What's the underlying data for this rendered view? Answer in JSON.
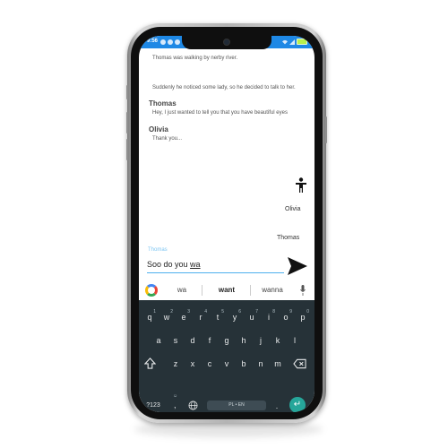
{
  "status": {
    "time": "9:56"
  },
  "story": {
    "narration_1": "Thomas was walking by nerby river.",
    "narration_2": "Suddenly he noticed some lady, so he decided to talk to her.",
    "dialogue": [
      {
        "speaker": "Thomas",
        "text": "Hey, I just wanted to tell you that you have beautiful eyes"
      },
      {
        "speaker": "Olivia",
        "text": "Thank you..."
      }
    ],
    "characters": [
      "Olivia",
      "Thomas"
    ]
  },
  "composer": {
    "hint": "Thomas",
    "value_plain": "Soo do you ",
    "value_underlined": "wa"
  },
  "keyboard": {
    "suggestions": [
      "wa",
      "want",
      "wanna"
    ],
    "row1": [
      {
        "k": "q",
        "s": "1"
      },
      {
        "k": "w",
        "s": "2"
      },
      {
        "k": "e",
        "s": "3"
      },
      {
        "k": "r",
        "s": "4"
      },
      {
        "k": "t",
        "s": "5"
      },
      {
        "k": "y",
        "s": "6"
      },
      {
        "k": "u",
        "s": "7"
      },
      {
        "k": "i",
        "s": "8"
      },
      {
        "k": "o",
        "s": "9"
      },
      {
        "k": "p",
        "s": "0"
      }
    ],
    "row2": [
      "a",
      "s",
      "d",
      "f",
      "g",
      "h",
      "j",
      "k",
      "l"
    ],
    "row3": [
      "z",
      "x",
      "c",
      "v",
      "b",
      "n",
      "m"
    ],
    "symbols_key": "?123",
    "comma_key": ",",
    "space_label": "PL • EN",
    "period_key": ".",
    "emoji_hint": "☺"
  },
  "colors": {
    "accent": "#1e88e5",
    "keyboard_bg": "#263238",
    "enter": "#26a69a"
  }
}
